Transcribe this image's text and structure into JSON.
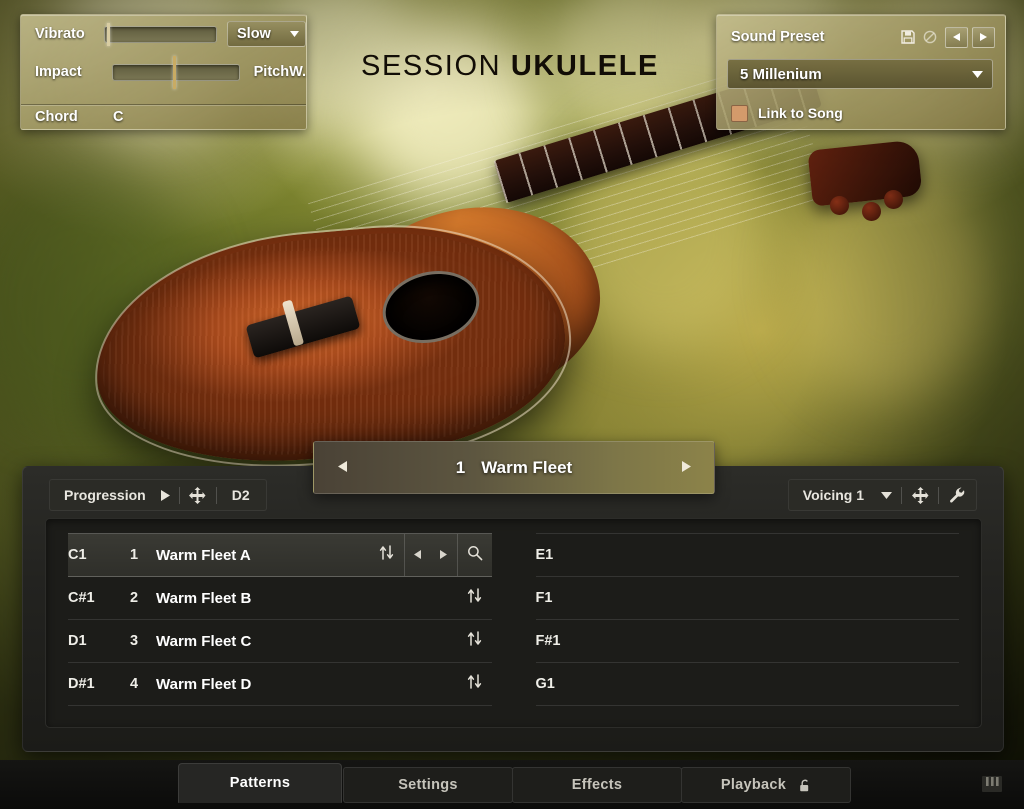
{
  "app": {
    "title_thin": "SESSION",
    "title_bold": "UKULELE",
    "accent_color": "#d39a6b",
    "panel_color": "#a59c68"
  },
  "performance_panel": {
    "vibrato": {
      "label": "Vibrato",
      "slider_value_pct": 2,
      "mod_label": "Slow",
      "mod_icon": "chevron-down-icon"
    },
    "impact": {
      "label": "Impact",
      "slider_value_pct": 48,
      "mod_label": "PitchW."
    },
    "chord": {
      "label": "Chord",
      "value": "C"
    }
  },
  "sound_preset": {
    "header_label": "Sound Preset",
    "icons": [
      "save-icon",
      "reset-icon"
    ],
    "prev_icon": "arrow-left-icon",
    "next_icon": "arrow-right-icon",
    "selected_preset": "5 Millenium",
    "dropdown_icon": "chevron-down-icon",
    "link_to_song": {
      "label": "Link to Song",
      "enabled": true
    }
  },
  "pattern_selector": {
    "prev_icon": "triangle-left-icon",
    "next_icon": "triangle-right-icon",
    "number": "1",
    "name": "Warm Fleet"
  },
  "left_toolbar": {
    "mode_label": "Progression",
    "play_icon": "triangle-right-icon",
    "move_icon": "move-icon",
    "key_label": "D2"
  },
  "right_toolbar": {
    "voicing_label": "Voicing 1",
    "dropdown_icon": "chevron-down-icon",
    "move_icon": "move-icon",
    "wrench_icon": "wrench-icon"
  },
  "pattern_list": {
    "left_column": [
      {
        "note": "C1",
        "index": "1",
        "name": "Warm Fleet A",
        "selected": true,
        "icons": [
          "updown-icon",
          "triangle-left-icon",
          "triangle-right-icon",
          "magnifier-icon"
        ]
      },
      {
        "note": "C#1",
        "index": "2",
        "name": "Warm Fleet B",
        "selected": false,
        "icons": [
          "updown-icon"
        ]
      },
      {
        "note": "D1",
        "index": "3",
        "name": "Warm Fleet C",
        "selected": false,
        "icons": [
          "updown-icon"
        ]
      },
      {
        "note": "D#1",
        "index": "4",
        "name": "Warm Fleet D",
        "selected": false,
        "icons": [
          "updown-icon"
        ]
      }
    ],
    "right_column": [
      {
        "note": "E1",
        "index": "",
        "name": "",
        "selected": false,
        "icons": []
      },
      {
        "note": "F1",
        "index": "",
        "name": "",
        "selected": false,
        "icons": []
      },
      {
        "note": "F#1",
        "index": "",
        "name": "",
        "selected": false,
        "icons": []
      },
      {
        "note": "G1",
        "index": "",
        "name": "",
        "selected": false,
        "icons": []
      }
    ]
  },
  "tabs": [
    {
      "label": "Patterns",
      "active": true,
      "lock": false
    },
    {
      "label": "Settings",
      "active": false,
      "lock": false
    },
    {
      "label": "Effects",
      "active": false,
      "lock": false
    },
    {
      "label": "Playback",
      "active": false,
      "lock": true
    }
  ],
  "status_bar": {
    "keyboard_icon": "piano-keys-icon"
  }
}
